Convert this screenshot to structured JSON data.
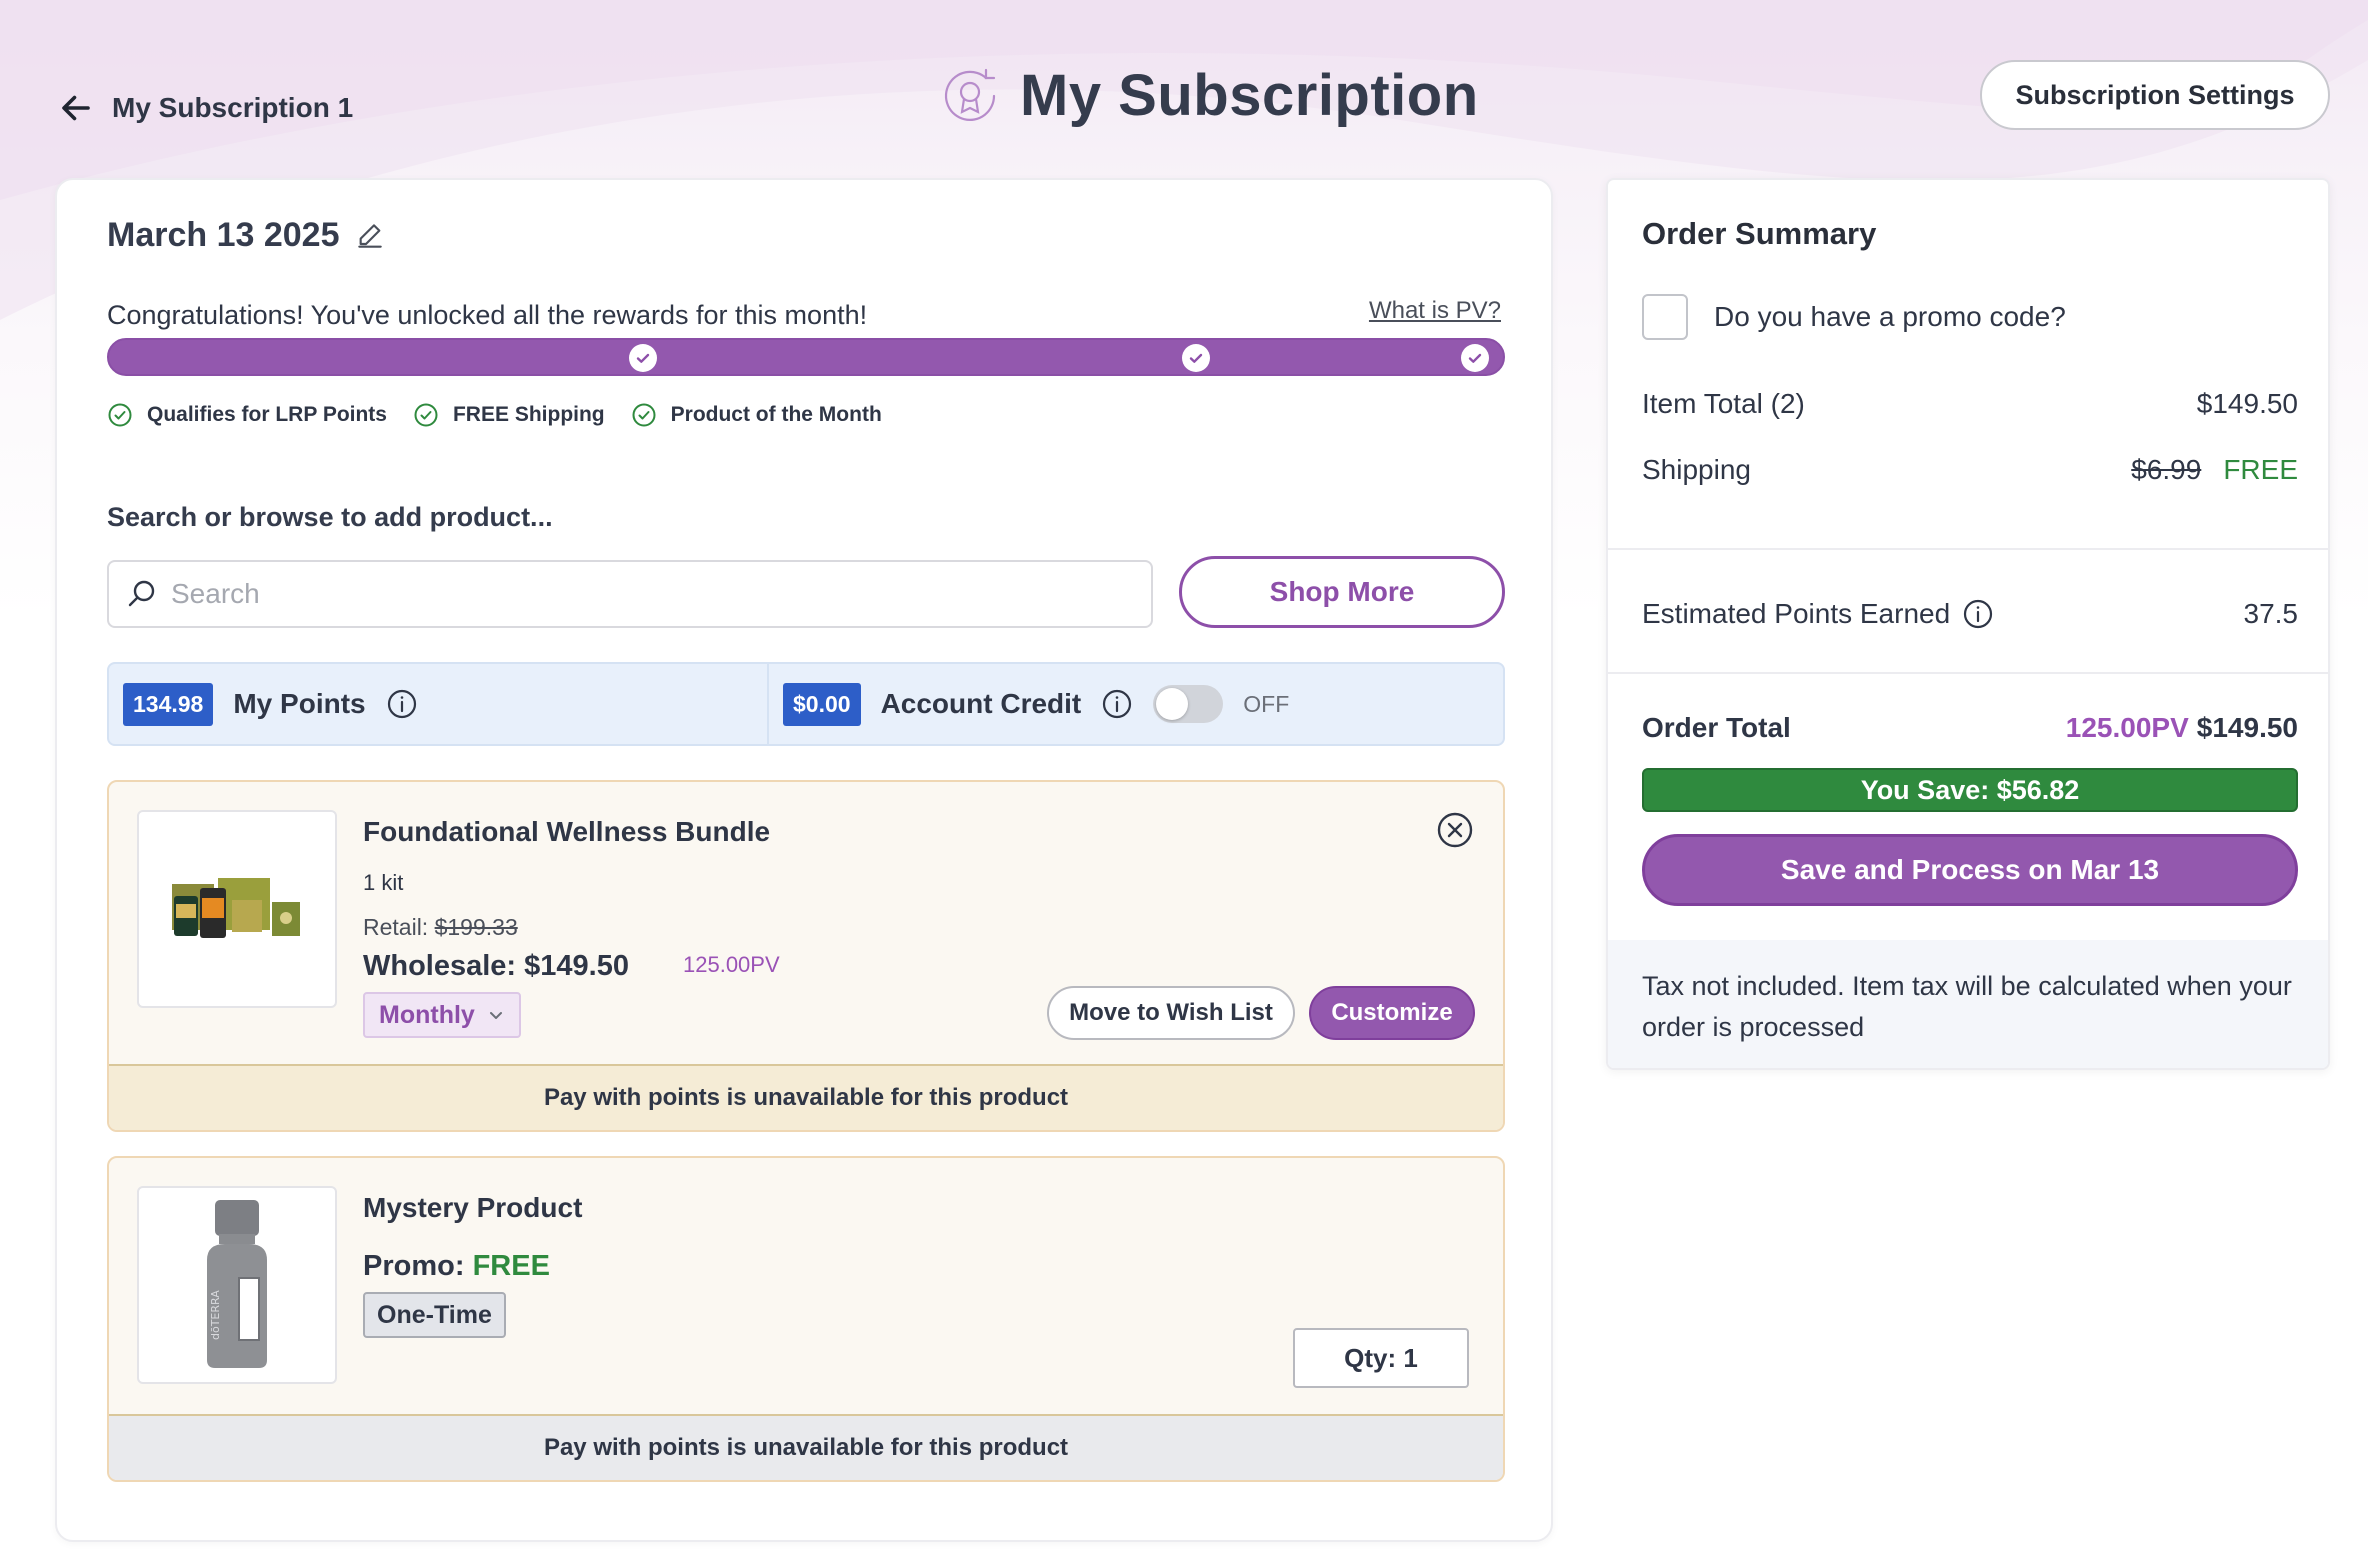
{
  "header": {
    "back_label": "My Subscription 1",
    "title": "My Subscription",
    "settings_button": "Subscription Settings"
  },
  "subscription": {
    "date": "March 13 2025",
    "congrats_text": "Congratulations! You've unlocked all the rewards for this month!",
    "what_is_pv": "What is PV?",
    "progress_fraction": 1.0,
    "rewards": [
      {
        "label": "Qualifies for LRP Points"
      },
      {
        "label": "FREE Shipping"
      },
      {
        "label": "Product of the Month"
      }
    ]
  },
  "search": {
    "label": "Search or browse to add product...",
    "placeholder": "Search",
    "value": "",
    "shop_more": "Shop More"
  },
  "points": {
    "my_points_value": "134.98",
    "my_points_label": "My Points",
    "credit_value": "$0.00",
    "credit_label": "Account Credit",
    "toggle_state": "OFF"
  },
  "products": [
    {
      "name": "Foundational Wellness Bundle",
      "quantity_text": "1 kit",
      "retail_label": "Retail:",
      "retail_price": "$199.33",
      "wholesale": "Wholesale: $149.50",
      "pv": "125.00PV",
      "frequency": "Monthly",
      "wish_list": "Move to Wish List",
      "customize": "Customize",
      "points_note": "Pay with points is unavailable for this product",
      "image_icon": "supplement-bundle-image"
    },
    {
      "name": "Mystery Product",
      "promo_label": "Promo:",
      "promo_value": "FREE",
      "frequency": "One-Time",
      "qty": "Qty: 1",
      "points_note": "Pay with points is unavailable for this product",
      "image_icon": "essential-oil-bottle-image",
      "bottle_brand": "dōTERRA"
    }
  ],
  "summary": {
    "title": "Order Summary",
    "promo_question": "Do you have a promo code?",
    "item_total_label": "Item Total (2)",
    "item_total_value": "$149.50",
    "shipping_label": "Shipping",
    "shipping_original": "$6.99",
    "shipping_value": "FREE",
    "est_points_label": "Estimated Points Earned",
    "est_points_value": "37.5",
    "order_total_label": "Order Total",
    "order_total_pv": "125.00PV",
    "order_total_value": "$149.50",
    "you_save": "You Save:  $56.82",
    "process_button": "Save and Process on Mar 13",
    "tax_note": "Tax not included. Item tax will be calculated when your order is processed"
  },
  "colors": {
    "brand_purple": "#9358ae",
    "success_green": "#2f8a3e",
    "badge_blue": "#2d5ec8",
    "product_border": "#efd7b4"
  }
}
